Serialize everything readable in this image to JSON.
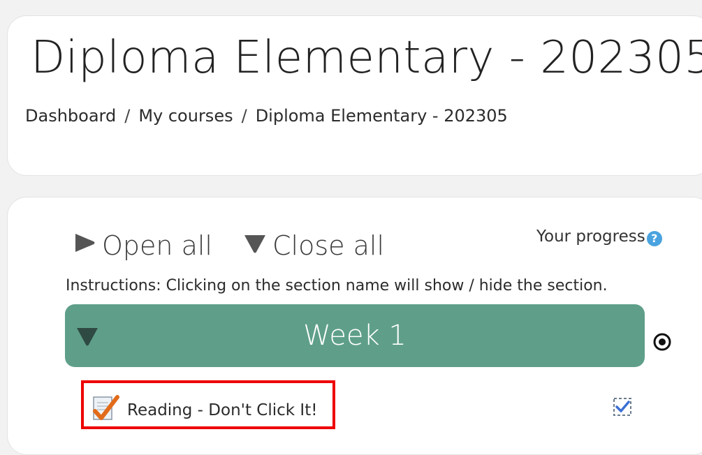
{
  "header": {
    "title": "Diploma Elementary - 202305",
    "breadcrumb": [
      "Dashboard",
      "My courses",
      "Diploma Elementary - 202305"
    ],
    "separator": "/"
  },
  "controls": {
    "open_all": "Open all",
    "close_all": "Close all",
    "progress_label": "Your progress",
    "help_icon": "?"
  },
  "instructions": "Instructions: Clicking on the section name will show / hide the section.",
  "section": {
    "title": "Week 1",
    "color": "#5f9f89"
  },
  "activity": {
    "name": "Reading - Don't Click It!",
    "icon": "checked-page-icon",
    "completion": "completed-checkbox-icon"
  },
  "colors": {
    "highlight_border": "#ee0000",
    "help": "#4aa3df"
  }
}
